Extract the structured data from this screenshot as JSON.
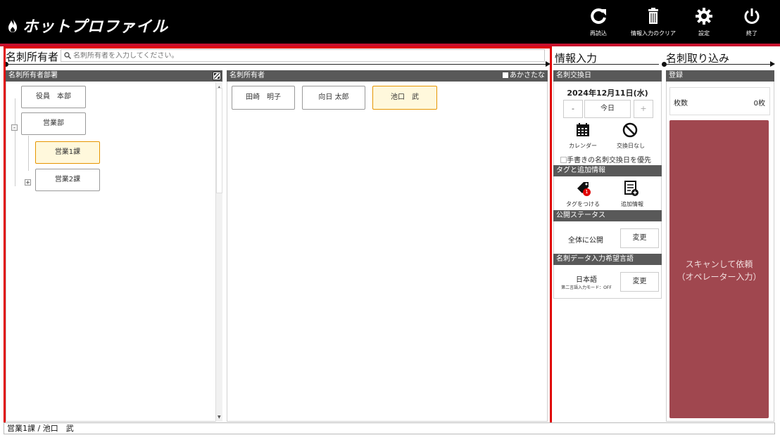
{
  "app": {
    "brand": "ホットプロファイル"
  },
  "toolbar": {
    "reload_label": "再読込",
    "clear_label": "情報入力のクリア",
    "settings_label": "設定",
    "exit_label": "終了"
  },
  "owner_section": {
    "title": "名刺所有者",
    "search_placeholder": "名刺所有者を入力してください。",
    "dept_header": "名刺所有者部署",
    "owner_header": "名刺所有者",
    "aiueo_label": "あかさたな",
    "departments": [
      "役員　本部",
      "営業部",
      "営業1課",
      "営業2課"
    ],
    "owners": [
      "田崎　明子",
      "向日 太郎",
      "池口　武"
    ]
  },
  "info_section": {
    "title": "情報入力",
    "exchange_date_header": "名刺交換日",
    "date": "2024年12月11日(水)",
    "minus": "-",
    "today": "今日",
    "plus": "+",
    "calendar_label": "カレンダー",
    "no_date_label": "交換日なし",
    "handwritten_label": "手書きの名刺交換日を優先",
    "tags_header": "タグと追加情報",
    "tag_label": "タグをつける",
    "tag_badge": "1",
    "extra_label": "追加情報",
    "visibility_header": "公開ステータス",
    "visibility_value": "全体に公開",
    "change_label": "変更",
    "language_header": "名刺データ入力希望言語",
    "language_value": "日本語",
    "second_lang_mode": "第二言語入力モード：OFF",
    "change_label2": "変更"
  },
  "import_section": {
    "title": "名刺取り込み",
    "register_header": "登録",
    "count_label": "枚数",
    "count_value": "0枚",
    "scan_line1": "スキャンして依頼",
    "scan_line2": "（オペレーター入力）"
  },
  "status_bar": {
    "text": "営業1課 / 池口　武"
  },
  "colors": {
    "accent_red": "#c8102e",
    "selected_fill": "#fff8dc",
    "selected_border": "#e69500",
    "scan_button": "#a0474f"
  }
}
